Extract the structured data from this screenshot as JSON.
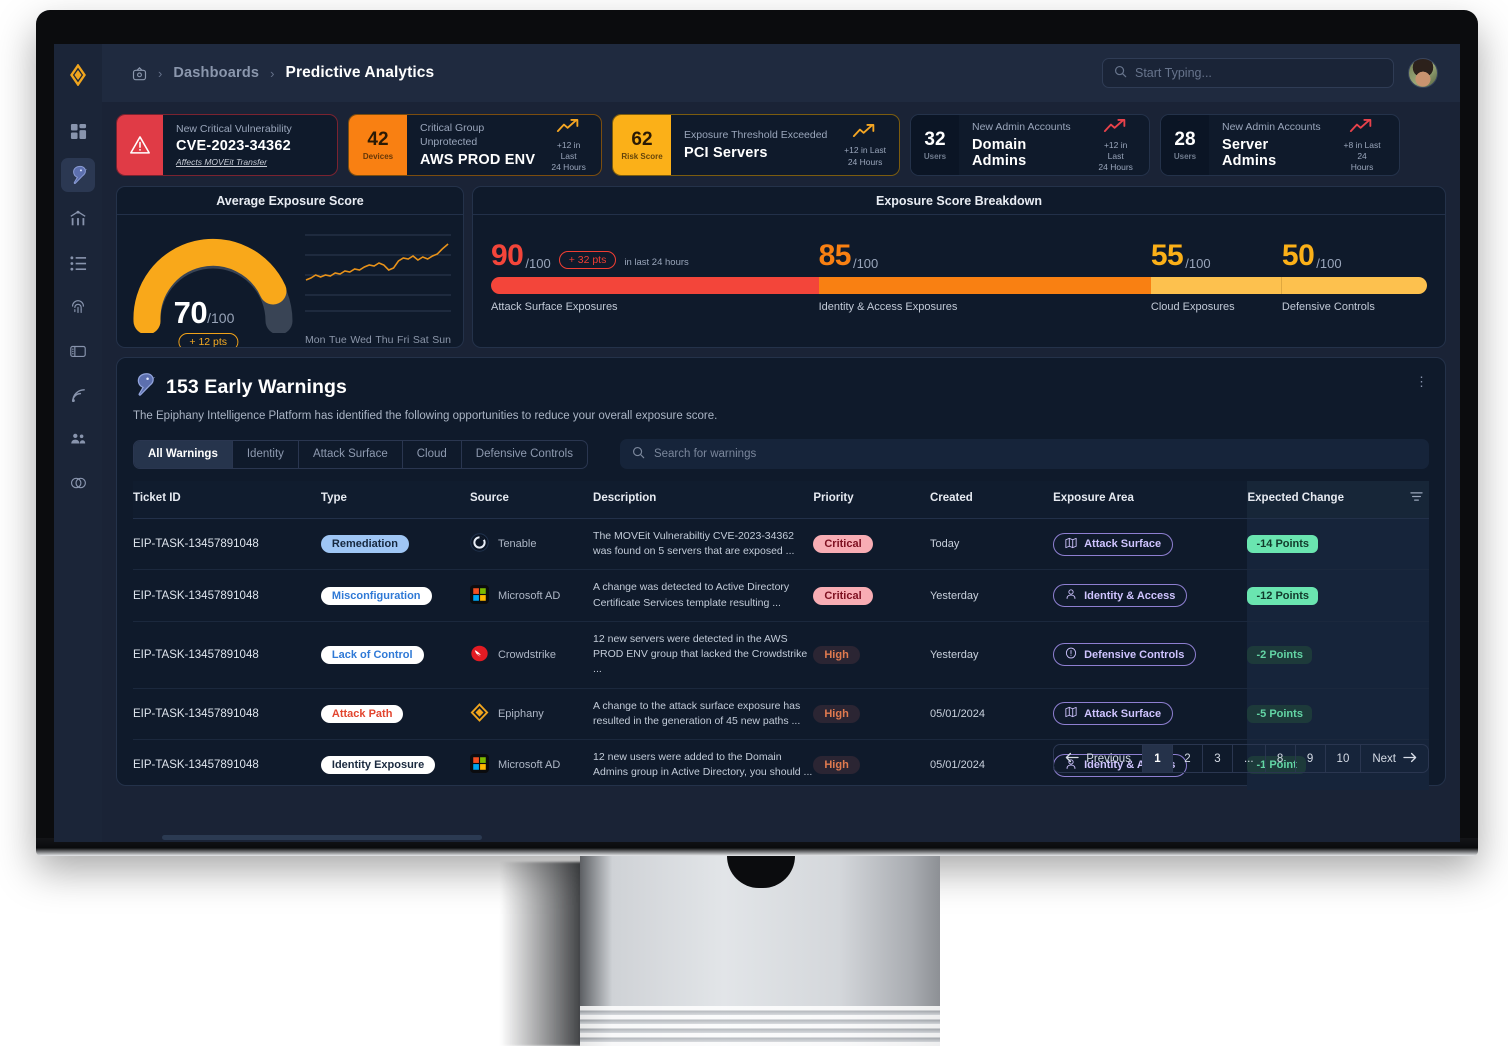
{
  "brand": {
    "accent": "#f5a623",
    "logo_icon": "diamond-logo-icon"
  },
  "sidebar": {
    "items": [
      {
        "name": "dashboard-icon",
        "label": "Dashboard"
      },
      {
        "name": "epiphany-bird-icon",
        "label": "Predictive Analytics",
        "active": true
      },
      {
        "name": "attack-path-icon",
        "label": "Attack Paths"
      },
      {
        "name": "list-icon",
        "label": "Inventory"
      },
      {
        "name": "fingerprint-icon",
        "label": "Identity"
      },
      {
        "name": "panel-icon",
        "label": "Reports"
      },
      {
        "name": "broadcast-icon",
        "label": "Feeds"
      },
      {
        "name": "users-icon",
        "label": "Users"
      },
      {
        "name": "integrations-icon",
        "label": "Integrations"
      }
    ]
  },
  "header": {
    "home_icon": "home-icon",
    "separator": "›",
    "breadcrumb_parent": "Dashboards",
    "breadcrumb_current": "Predictive Analytics",
    "search_placeholder": "Start Typing...",
    "search_icon": "search-icon",
    "avatar_name": "user-avatar"
  },
  "kpis": [
    {
      "style": "alert",
      "badge_icon": "warning-triangle-icon",
      "label": "New Critical Vulnerability",
      "value": "CVE-2023-34362",
      "sub": "Affects MOVEit Transfer",
      "sub_icon": "copy-icon"
    },
    {
      "style": "orange",
      "badge_num": "42",
      "badge_unit": "Devices",
      "label": "Critical Group Unprotected",
      "value": "AWS PROD ENV",
      "trend_icon": "trend-up-icon",
      "trend_color": "#f5a623",
      "trend_line1": "+12 in Last",
      "trend_line2": "24 Hours"
    },
    {
      "style": "amber",
      "badge_num": "62",
      "badge_unit": "Risk Score",
      "label": "Exposure Threshold Exceeded",
      "value": "PCI Servers",
      "trend_icon": "trend-up-icon",
      "trend_color": "#f5a623",
      "trend_line1": "+12 in Last",
      "trend_line2": "24 Hours"
    },
    {
      "style": "plain",
      "badge_num": "32",
      "badge_unit": "Users",
      "label": "New Admin Accounts",
      "value": "Domain Admins",
      "trend_icon": "trend-up-icon",
      "trend_color": "#e8424b",
      "trend_line1": "+12 in Last",
      "trend_line2": "24 Hours"
    },
    {
      "style": "plain",
      "badge_num": "28",
      "badge_unit": "Users",
      "label": "New Admin Accounts",
      "value": "Server Admins",
      "trend_icon": "trend-up-icon",
      "trend_color": "#e8424b",
      "trend_line1": "+8 in Last 24",
      "trend_line2": "Hours"
    }
  ],
  "gauge_panel": {
    "title": "Average Exposure Score",
    "score": "70",
    "out_of": "/100",
    "delta": "+ 12 pts",
    "day_labels": [
      "Mon",
      "Tue",
      "Wed",
      "Thu",
      "Fri",
      "Sat",
      "Sun"
    ]
  },
  "breakdown_panel": {
    "title": "Exposure Score Breakdown",
    "delta_chip": "+ 32 pts",
    "delta_note": "in last 24 hours",
    "segments": [
      {
        "value": "90",
        "out_of": "/100",
        "label": "Attack Surface Exposures",
        "color": "#f3453a",
        "width_pct": 35
      },
      {
        "value": "85",
        "out_of": "/100",
        "label": "Identity & Access Exposures",
        "color": "#f98012",
        "width_pct": 35.5
      },
      {
        "value": "55",
        "out_of": "/100",
        "label": "Cloud Exposures",
        "color": "#fdc14e",
        "width_pct": 14
      },
      {
        "value": "50",
        "out_of": "/100",
        "label": "Defensive Controls",
        "color": "#fdc14e",
        "width_pct": 15.5
      }
    ]
  },
  "warnings": {
    "icon": "epiphany-bird-icon",
    "title": "153 Early Warnings",
    "subtitle": "The Epiphany Intelligence Platform has identified the following opportunities to reduce your overall exposure score.",
    "kebab_icon": "more-vertical-icon",
    "tabs": [
      {
        "label": "All Warnings",
        "active": true
      },
      {
        "label": "Identity",
        "active": false
      },
      {
        "label": "Attack Surface",
        "active": false
      },
      {
        "label": "Cloud",
        "active": false
      },
      {
        "label": "Defensive Controls",
        "active": false
      }
    ],
    "search_placeholder": "Search for warnings",
    "search_icon": "search-icon",
    "filter_icon": "filter-icon",
    "columns": [
      "Ticket ID",
      "Type",
      "Source",
      "Description",
      "Priority",
      "Created",
      "Exposure Area",
      "Expected Change"
    ],
    "rows": [
      {
        "ticket_id": "EIP-TASK-13457891048",
        "type": "Remediation",
        "type_style": "rem",
        "source": "Tenable",
        "source_icon": "tenable-icon",
        "description": "The MOVEit Vulnerabiltiy CVE-2023-34362 was found on 5 servers that are exposed ...",
        "priority": "Critical",
        "priority_style": "critical",
        "created": "Today",
        "area": "Attack Surface",
        "area_icon": "map-icon",
        "change": "-14 Points",
        "change_style": "strong"
      },
      {
        "ticket_id": "EIP-TASK-13457891048",
        "type": "Misconfiguration",
        "type_style": "mis",
        "source": "Microsoft AD",
        "source_icon": "microsoft-icon",
        "description": "A change was detected to Active Directory Certificate Services template resulting  ...",
        "priority": "Critical",
        "priority_style": "critical",
        "created": "Yesterday",
        "area": "Identity & Access",
        "area_icon": "person-icon",
        "change": "-12 Points",
        "change_style": "strong"
      },
      {
        "ticket_id": "EIP-TASK-13457891048",
        "type": "Lack of Control",
        "type_style": "lac",
        "source": "Crowdstrike",
        "source_icon": "crowdstrike-icon",
        "description": "12 new servers were detected in the AWS PROD ENV group that lacked the Crowdstrike ...",
        "priority": "High",
        "priority_style": "high",
        "created": "Yesterday",
        "area": "Defensive Controls",
        "area_icon": "shield-alert-icon",
        "change": "-2 Points",
        "change_style": "soft"
      },
      {
        "ticket_id": "EIP-TASK-13457891048",
        "type": "Attack Path",
        "type_style": "atk",
        "source": "Epiphany",
        "source_icon": "epiphany-diamond-icon",
        "description": "A change to the attack surface exposure has resulted in the generation of 45 new paths ...",
        "priority": "High",
        "priority_style": "high",
        "created": "05/01/2024",
        "area": "Attack Surface",
        "area_icon": "map-icon",
        "change": "-5 Points",
        "change_style": "soft"
      },
      {
        "ticket_id": "EIP-TASK-13457891048",
        "type": "Identity Exposure",
        "type_style": "ide",
        "source": "Microsoft AD",
        "source_icon": "microsoft-icon",
        "description": "12 new users were added to the Domain Admins group in Active Directory, you should ...",
        "priority": "High",
        "priority_style": "high",
        "created": "05/01/2024",
        "area": "Identity & Access",
        "area_icon": "person-icon",
        "change": "-1 Point",
        "change_style": "soft"
      }
    ],
    "pagination": {
      "previous": "Previous",
      "previous_icon": "arrow-left-icon",
      "next": "Next",
      "next_icon": "arrow-right-icon",
      "pages": [
        "1",
        "2",
        "3",
        "...",
        "8",
        "9",
        "10"
      ],
      "current": "1"
    }
  },
  "chart_data": {
    "type": "line",
    "title": "Average Exposure Score trend",
    "x": [
      "Mon",
      "Tue",
      "Wed",
      "Thu",
      "Fri",
      "Sat",
      "Sun"
    ],
    "values": [
      52,
      54,
      56,
      58,
      62,
      66,
      70
    ],
    "ylim": [
      0,
      100
    ],
    "grid": true,
    "legend": "none",
    "color": "#e8921a"
  }
}
